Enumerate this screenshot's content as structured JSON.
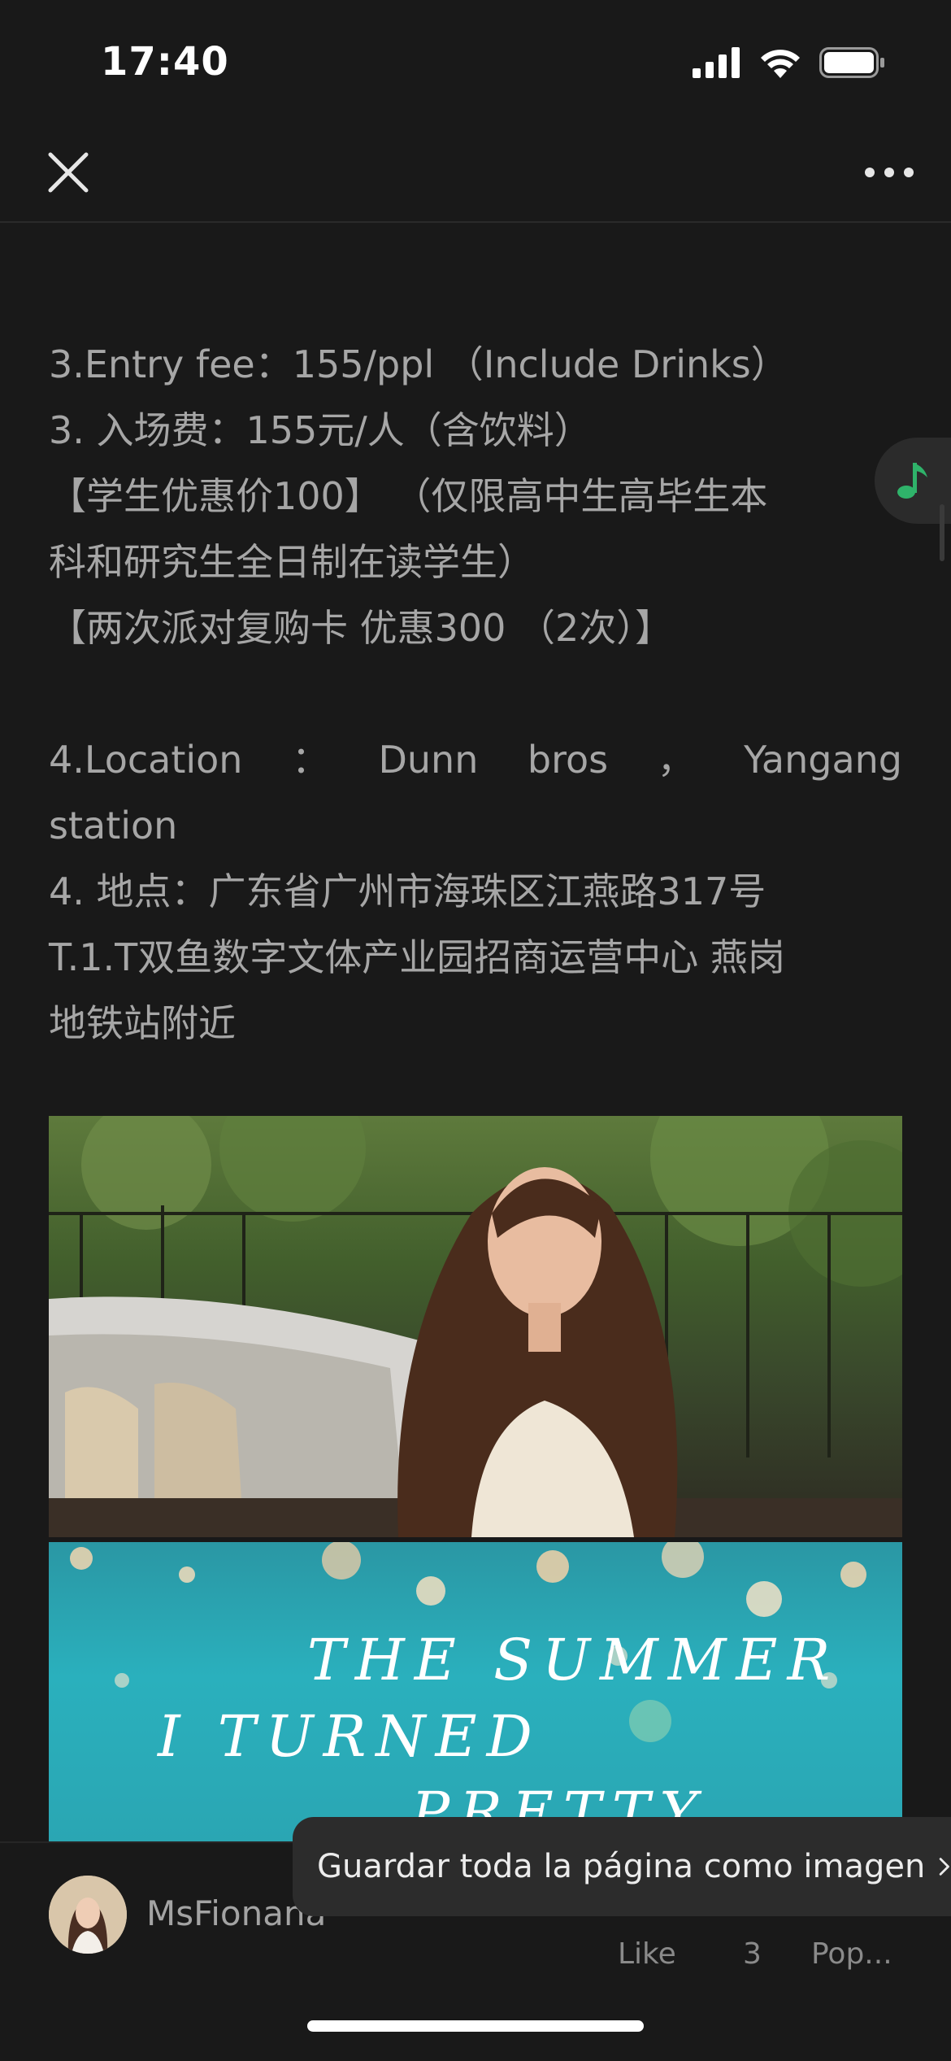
{
  "status_bar": {
    "time": "17:40"
  },
  "nav": {
    "close_icon": "close-icon",
    "more_icon": "more-horizontal-icon"
  },
  "article": {
    "lines": [
      "3.Entry fee：155/ppl （Include Drinks）",
      "3. 入场费：155元/人（含饮料）",
      "【学生优惠价100】 （仅限高中生高毕生本",
      "科和研究生全日制在读学生）",
      "【两次派对复购卡 优惠300 （2次）】"
    ],
    "location_en_words": [
      "4.Location",
      "：",
      "Dunn",
      "bros",
      "，",
      "Yangang"
    ],
    "location_en_tail": "station",
    "location_zh": [
      "4. 地点：广东省广州市海珠区江燕路317号",
      "T.1.T双鱼数字文体产业园招商运营中心 燕岗",
      "地铁站附近"
    ]
  },
  "images": {
    "show_title_line1": "THE SUMMER",
    "show_title_line2": "I TURNED",
    "show_title_line3": "PRETTY"
  },
  "author": {
    "name": "MsFionana"
  },
  "actions": {
    "like_label": "Like",
    "like_count": "3",
    "pop_label": "Pop..."
  },
  "toast": {
    "text": "Guardar toda la página como imagen"
  },
  "music_icon": "music-note-icon",
  "colors": {
    "background": "#191919",
    "text": "#a6a6a6",
    "music_green": "#2fb36a"
  }
}
